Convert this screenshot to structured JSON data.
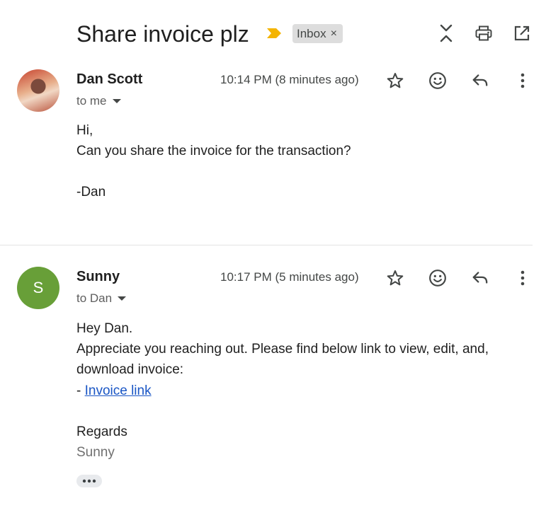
{
  "thread": {
    "subject": "Share invoice plz",
    "label": "Inbox",
    "label_remove": "×",
    "importance_color": "#f4b400"
  },
  "header_actions": [
    "collapse-all-icon",
    "print-icon",
    "open-in-new-window-icon"
  ],
  "messages": [
    {
      "sender": "Dan Scott",
      "recipient": "to me",
      "timestamp": "10:14 PM (8 minutes ago)",
      "avatar": "photo",
      "body": {
        "line1": "Hi,",
        "line2": "Can you share the invoice for the transaction?",
        "line3": "-Dan"
      }
    },
    {
      "sender": "Sunny",
      "recipient": "to Dan",
      "timestamp": "10:17 PM (5 minutes ago)",
      "avatar": "S",
      "avatar_color": "#689f38",
      "body": {
        "line1": "Hey Dan.",
        "line2": "Appreciate you reaching out. Please find below link to view, edit, and,",
        "line3": "download invoice:",
        "bullet": "- ",
        "link_text": "Invoice link",
        "closing": "Regards",
        "signature": "Sunny"
      },
      "trimmed_content": "•••"
    }
  ],
  "message_actions": [
    "star-icon",
    "emoji-reaction-icon",
    "reply-icon",
    "more-options-icon"
  ],
  "accent_colors": {
    "link": "#1a56c5",
    "text": "#1f1f1f",
    "secondary_text": "#5e5e5e"
  }
}
